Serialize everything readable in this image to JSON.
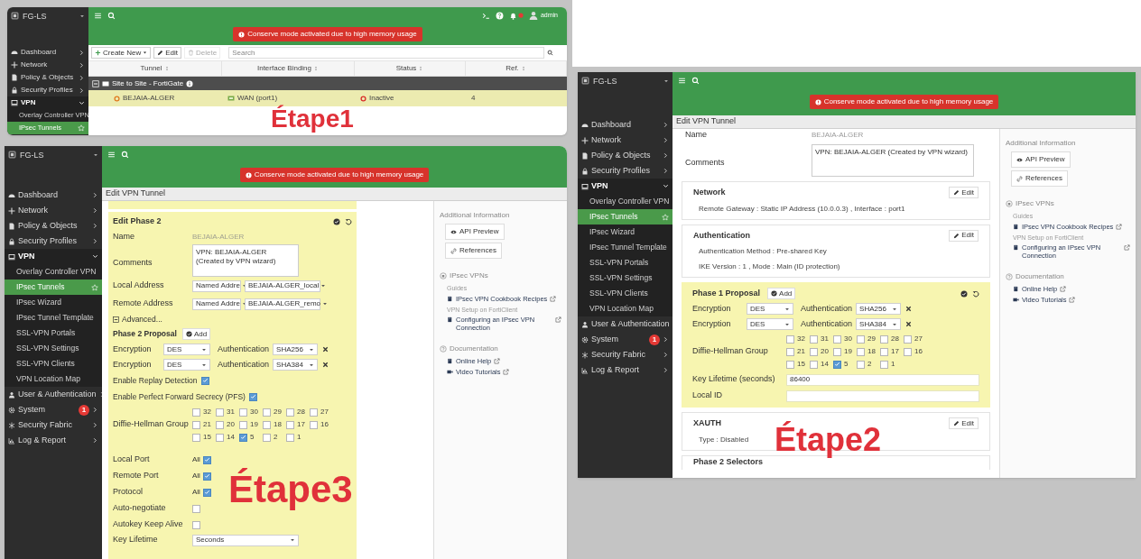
{
  "screenshots": [
    {
      "kind": "tunnel_list",
      "caption": "Étape1",
      "sidebar": {
        "device": "FG-LS",
        "items": [
          {
            "label": "Dashboard",
            "expanded": false
          },
          {
            "label": "Network",
            "expanded": false
          },
          {
            "label": "Policy & Objects",
            "expanded": false
          },
          {
            "label": "Security Profiles",
            "expanded": false
          },
          {
            "label": "VPN",
            "expanded": true,
            "children": [
              {
                "label": "Overlay Controller VPN",
                "selected": false
              },
              {
                "label": "IPsec Tunnels",
                "selected": true
              }
            ]
          }
        ]
      },
      "header": {
        "alert": "Conserve mode activated due to high memory usage",
        "user": "admin"
      },
      "toolbar": {
        "buttons": [
          {
            "label": "Create New",
            "kind": "create",
            "disabled": false
          },
          {
            "label": "Edit",
            "kind": "edit",
            "disabled": false
          },
          {
            "label": "Delete",
            "kind": "delete",
            "disabled": true
          }
        ],
        "search_placeholder": "Search"
      },
      "table": {
        "columns": [
          "Tunnel",
          "Interface Binding",
          "Status",
          "Ref."
        ],
        "groups": [
          {
            "label": "Site to Site - FortiGate",
            "rows": [
              {
                "cells": [
                  "BEJAIA-ALGER",
                  "WAN (port1)",
                  "Inactive",
                  "4"
                ],
                "selected": true
              }
            ]
          }
        ]
      }
    },
    {
      "kind": "edit_phase1",
      "caption": "Étape2",
      "sidebar": {
        "device": "FG-LS",
        "items": [
          {
            "label": "Dashboard",
            "expanded": false
          },
          {
            "label": "Network",
            "expanded": false
          },
          {
            "label": "Policy & Objects",
            "expanded": false
          },
          {
            "label": "Security Profiles",
            "expanded": false
          },
          {
            "label": "VPN",
            "expanded": true,
            "children": [
              {
                "label": "Overlay Controller VPN",
                "selected": false
              },
              {
                "label": "IPsec Tunnels",
                "selected": true
              },
              {
                "label": "IPsec Wizard",
                "selected": false
              },
              {
                "label": "IPsec Tunnel Template",
                "selected": false
              },
              {
                "label": "SSL-VPN Portals",
                "selected": false
              },
              {
                "label": "SSL-VPN Settings",
                "selected": false
              },
              {
                "label": "SSL-VPN Clients",
                "selected": false
              },
              {
                "label": "VPN Location Map",
                "selected": false
              }
            ]
          },
          {
            "label": "User & Authentication",
            "expanded": false
          },
          {
            "label": "System",
            "expanded": false,
            "badge": "1"
          },
          {
            "label": "Security Fabric",
            "expanded": false
          },
          {
            "label": "Log & Report",
            "expanded": false
          }
        ]
      },
      "header": {
        "alert": "Conserve mode activated due to high memory usage"
      },
      "page_title": "Edit VPN Tunnel",
      "name": {
        "label": "Name",
        "value": "BEJAIA-ALGER"
      },
      "comments": {
        "label": "Comments",
        "value": "VPN: BEJAIA-ALGER (Created by VPN wizard)"
      },
      "sections": [
        {
          "title": "Network",
          "edit": "Edit",
          "lines": [
            "Remote Gateway : Static IP Address (10.0.0.3) , Interface : port1"
          ]
        },
        {
          "title": "Authentication",
          "edit": "Edit",
          "lines": [
            "Authentication Method : Pre-shared Key",
            "IKE Version : 1 , Mode : Main (ID protection)"
          ]
        }
      ],
      "proposal": {
        "title": "Phase 1 Proposal",
        "add": "Add",
        "rows": [
          {
            "enc_label": "Encryption",
            "enc": "DES",
            "auth_label": "Authentication",
            "auth": "SHA256"
          },
          {
            "enc_label": "Encryption",
            "enc": "DES",
            "auth_label": "Authentication",
            "auth": "SHA384"
          }
        ],
        "dh": {
          "label": "Diffie-Hellman Group",
          "groups": [
            {
              "label": "32",
              "checked": false
            },
            {
              "label": "31",
              "checked": false
            },
            {
              "label": "30",
              "checked": false
            },
            {
              "label": "29",
              "checked": false
            },
            {
              "label": "28",
              "checked": false
            },
            {
              "label": "27",
              "checked": false
            },
            {
              "label": "21",
              "checked": false
            },
            {
              "label": "20",
              "checked": false
            },
            {
              "label": "19",
              "checked": false
            },
            {
              "label": "18",
              "checked": false
            },
            {
              "label": "17",
              "checked": false
            },
            {
              "label": "16",
              "checked": false
            },
            {
              "label": "15",
              "checked": false
            },
            {
              "label": "14",
              "checked": false
            },
            {
              "label": "5",
              "checked": true
            },
            {
              "label": "2",
              "checked": false
            },
            {
              "label": "1",
              "checked": false
            }
          ]
        },
        "fields": [
          {
            "label": "Key Lifetime (seconds)",
            "value": "86400"
          },
          {
            "label": "Local ID"
          }
        ]
      },
      "after_sections": [
        {
          "title": "XAUTH",
          "edit": "Edit",
          "lines": [
            "Type : Disabled"
          ]
        }
      ],
      "last_section": "Phase 2 Selectors",
      "info": {
        "title": "Additional Information",
        "buttons": [
          "API Preview",
          "References"
        ],
        "groups": [
          {
            "title": "IPsec VPNs",
            "links": [
              {
                "caption": "Guides",
                "label": "IPsec VPN Cookbook Recipes",
                "kind": "doc"
              },
              {
                "caption": "VPN Setup on FortiClient",
                "label": "Configuring an IPsec VPN Connection",
                "kind": "doc"
              }
            ]
          },
          {
            "title": "Documentation",
            "links": [
              {
                "label": "Online Help",
                "kind": "doc"
              },
              {
                "label": "Video Tutorials",
                "kind": "video"
              }
            ]
          }
        ]
      }
    },
    {
      "kind": "edit_phase2",
      "caption": "Étape3",
      "sidebar": {
        "device": "FG-LS",
        "items": [
          {
            "label": "Dashboard",
            "expanded": false
          },
          {
            "label": "Network",
            "expanded": false
          },
          {
            "label": "Policy & Objects",
            "expanded": false
          },
          {
            "label": "Security Profiles",
            "expanded": false
          },
          {
            "label": "VPN",
            "expanded": true,
            "children": [
              {
                "label": "Overlay Controller VPN",
                "selected": false
              },
              {
                "label": "IPsec Tunnels",
                "selected": true
              },
              {
                "label": "IPsec Wizard",
                "selected": false
              },
              {
                "label": "IPsec Tunnel Template",
                "selected": false
              },
              {
                "label": "SSL-VPN Portals",
                "selected": false
              },
              {
                "label": "SSL-VPN Settings",
                "selected": false
              },
              {
                "label": "SSL-VPN Clients",
                "selected": false
              },
              {
                "label": "VPN Location Map",
                "selected": false
              }
            ]
          },
          {
            "label": "User & Authentication",
            "expanded": false
          },
          {
            "label": "System",
            "expanded": false,
            "badge": "1"
          },
          {
            "label": "Security Fabric",
            "expanded": false
          },
          {
            "label": "Log & Report",
            "expanded": false
          }
        ]
      },
      "header": {
        "alert": "Conserve mode activated due to high memory usage"
      },
      "page_title": "Edit VPN Tunnel",
      "panel": {
        "title": "Edit Phase 2",
        "name": {
          "label": "Name",
          "value": "BEJAIA-ALGER"
        },
        "comments": {
          "label": "Comments",
          "value": "VPN: BEJAIA-ALGER (Created by VPN wizard)"
        },
        "addresses": [
          {
            "label": "Local Address",
            "type": "Named Addre",
            "value": "BEJAIA-ALGER_local"
          },
          {
            "label": "Remote Address",
            "type": "Named Addre",
            "value": "BEJAIA-ALGER_remo"
          }
        ],
        "advanced": "Advanced...",
        "proposal": {
          "title": "Phase 2 Proposal",
          "add": "Add",
          "rows": [
            {
              "enc_label": "Encryption",
              "enc": "DES",
              "auth_label": "Authentication",
              "auth": "SHA256"
            },
            {
              "enc_label": "Encryption",
              "enc": "DES",
              "auth_label": "Authentication",
              "auth": "SHA384"
            }
          ]
        },
        "toggles": [
          {
            "label": "Enable Replay Detection",
            "checked": true
          },
          {
            "label": "Enable Perfect Forward Secrecy (PFS)",
            "checked": true
          }
        ],
        "dh": {
          "label": "Diffie-Hellman Group",
          "groups": [
            {
              "label": "32",
              "checked": false
            },
            {
              "label": "31",
              "checked": false
            },
            {
              "label": "30",
              "checked": false
            },
            {
              "label": "29",
              "checked": false
            },
            {
              "label": "28",
              "checked": false
            },
            {
              "label": "27",
              "checked": false
            },
            {
              "label": "21",
              "checked": false
            },
            {
              "label": "20",
              "checked": false
            },
            {
              "label": "19",
              "checked": false
            },
            {
              "label": "18",
              "checked": false
            },
            {
              "label": "17",
              "checked": false
            },
            {
              "label": "16",
              "checked": false
            },
            {
              "label": "15",
              "checked": false
            },
            {
              "label": "14",
              "checked": false
            },
            {
              "label": "5",
              "checked": true
            },
            {
              "label": "2",
              "checked": false
            },
            {
              "label": "1",
              "checked": false
            }
          ]
        },
        "options": [
          {
            "label": "Local Port",
            "value": "All",
            "checked": true
          },
          {
            "label": "Remote Port",
            "value": "All",
            "checked": true
          },
          {
            "label": "Protocol",
            "value": "All",
            "checked": true
          },
          {
            "label": "Auto-negotiate",
            "checked": false
          },
          {
            "label": "Autokey Keep Alive",
            "checked": false
          }
        ],
        "key_lifetime": {
          "label": "Key Lifetime",
          "value": "Seconds"
        }
      },
      "info": {
        "title": "Additional Information",
        "buttons": [
          "API Preview",
          "References"
        ],
        "groups": [
          {
            "title": "IPsec VPNs",
            "links": [
              {
                "caption": "Guides",
                "label": "IPsec VPN Cookbook Recipes",
                "kind": "doc"
              },
              {
                "caption": "VPN Setup on FortiClient",
                "label": "Configuring an IPsec VPN Connection",
                "kind": "doc"
              }
            ]
          },
          {
            "title": "Documentation",
            "links": [
              {
                "label": "Online Help",
                "kind": "doc"
              },
              {
                "label": "Video Tutorials",
                "kind": "video"
              }
            ]
          }
        ]
      }
    }
  ]
}
